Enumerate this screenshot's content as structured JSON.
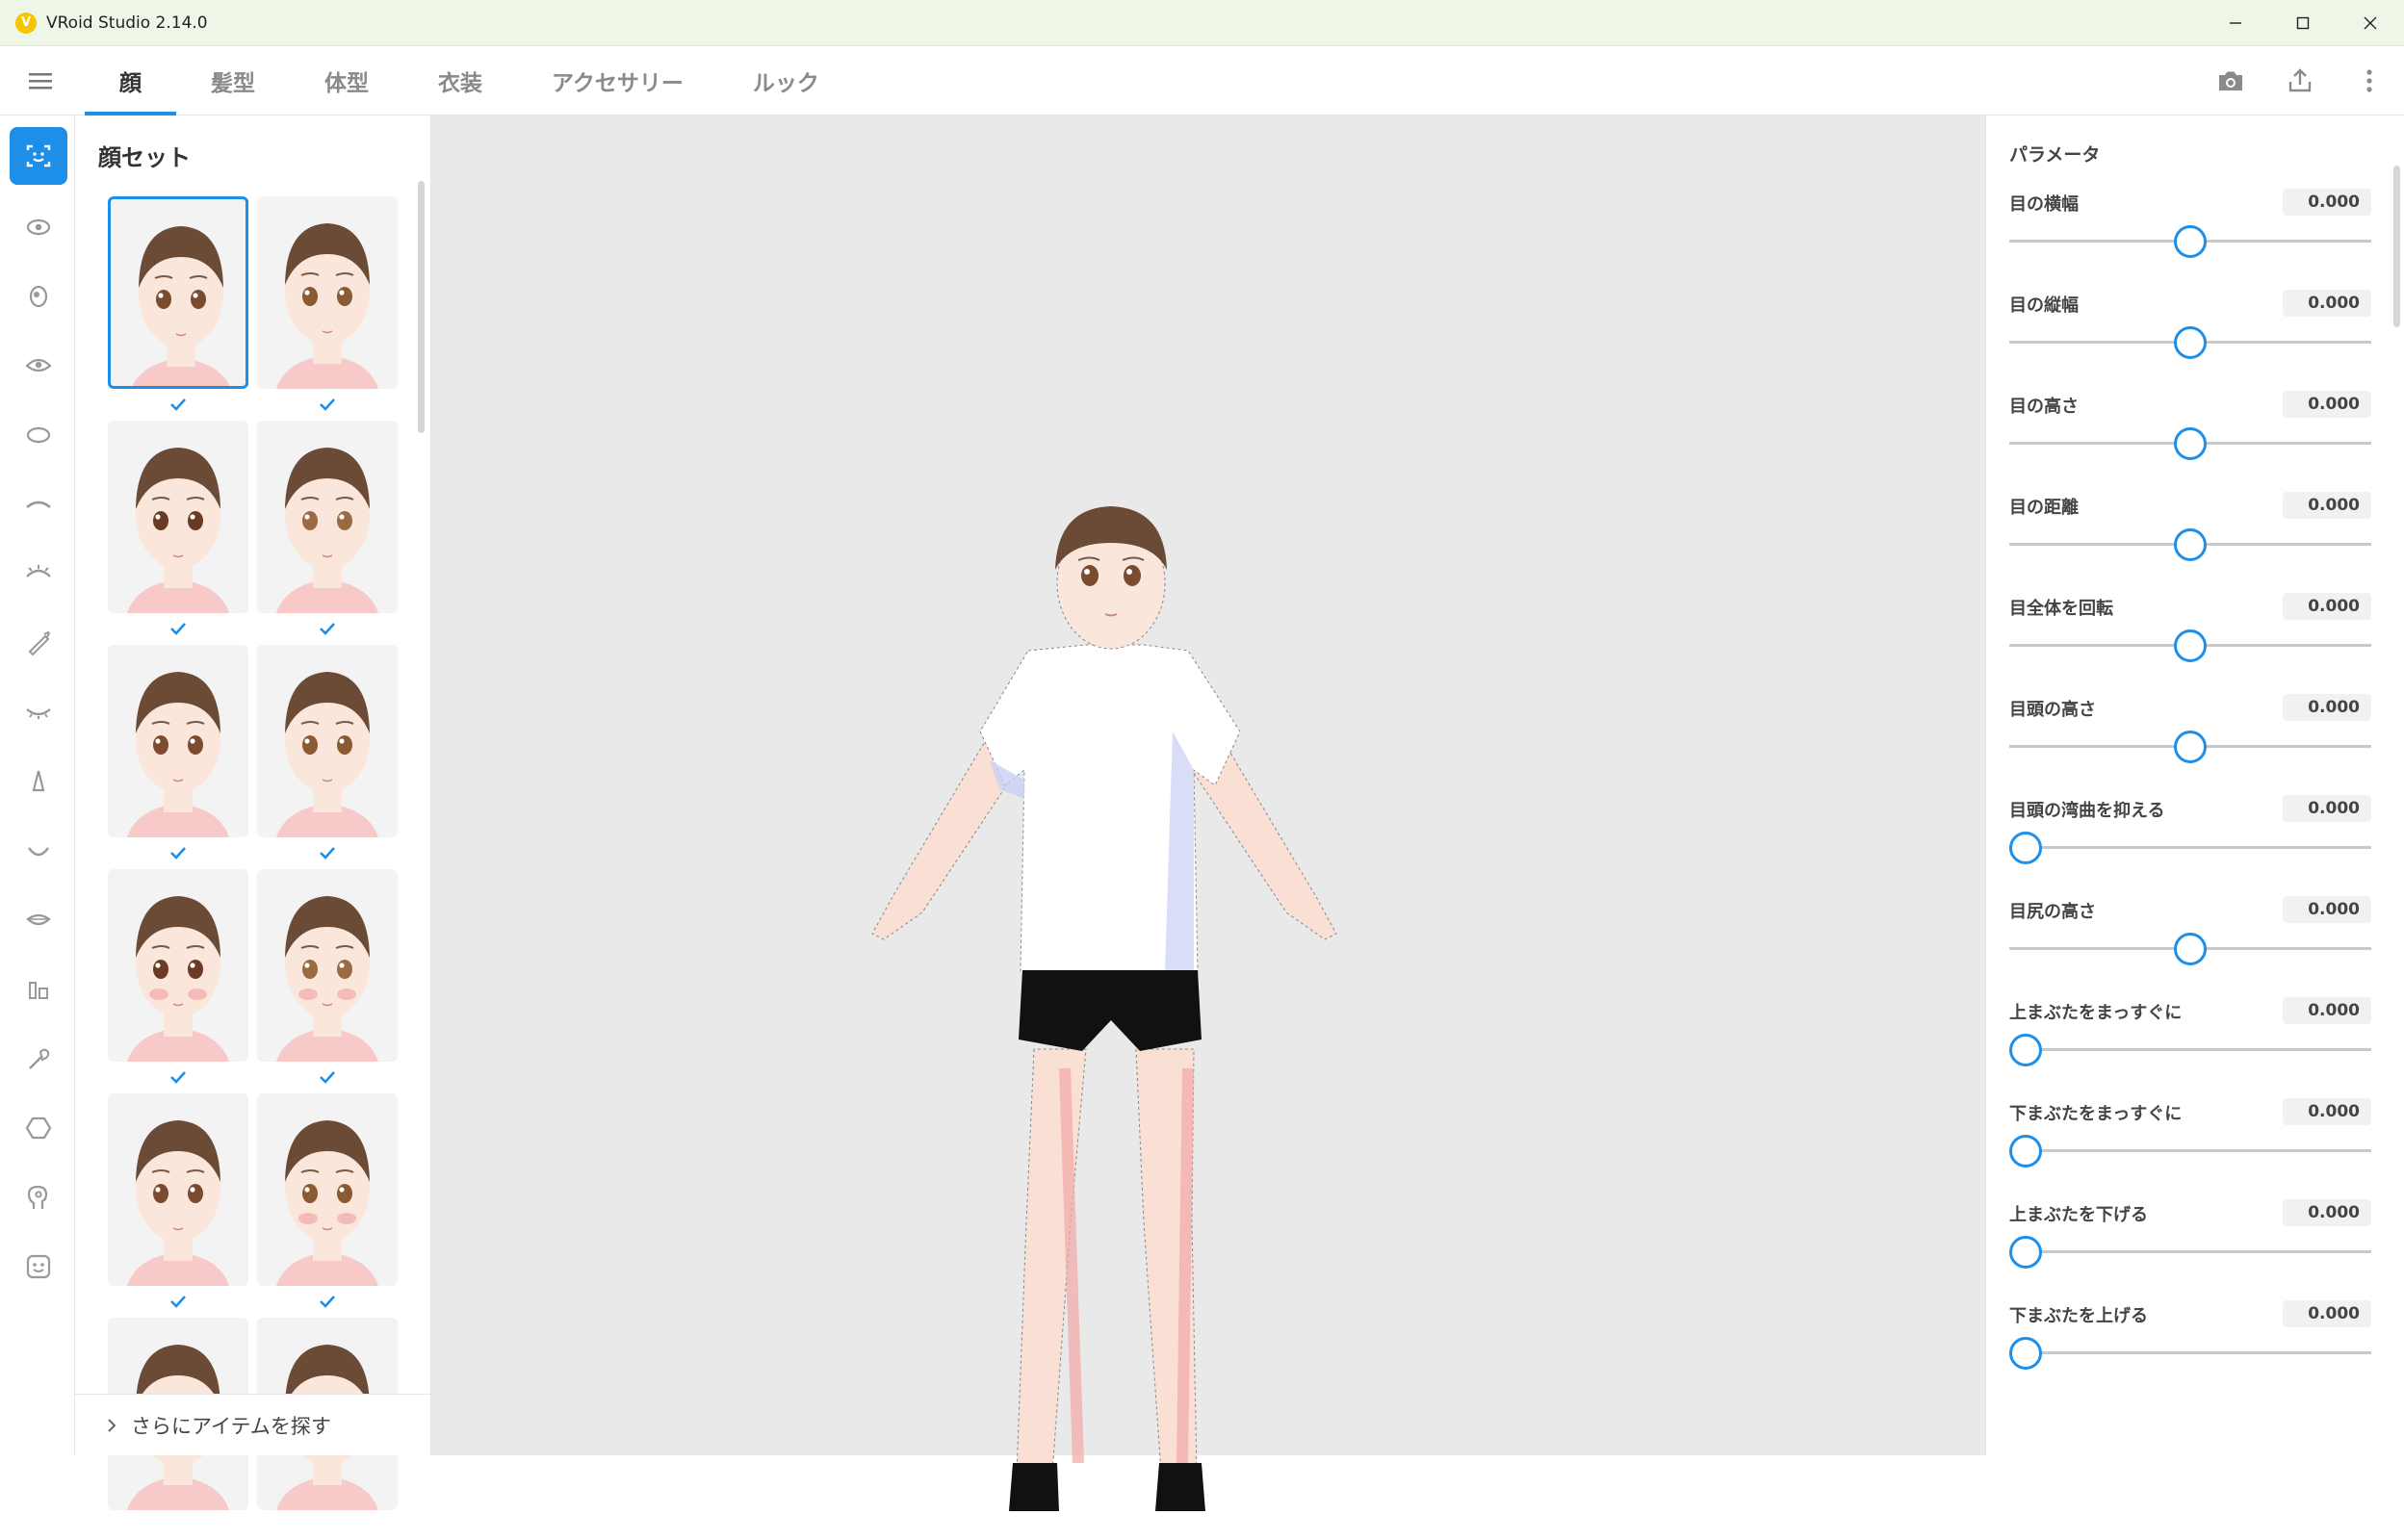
{
  "window": {
    "title": "VRoid Studio 2.14.0"
  },
  "tabs": [
    {
      "label": "顔",
      "active": true
    },
    {
      "label": "髪型",
      "active": false
    },
    {
      "label": "体型",
      "active": false
    },
    {
      "label": "衣装",
      "active": false
    },
    {
      "label": "アクセサリー",
      "active": false
    },
    {
      "label": "ルック",
      "active": false
    }
  ],
  "top_actions": [
    "camera-icon",
    "export-icon",
    "more-vert-icon"
  ],
  "rail_icons": [
    "face-set-icon",
    "eye-set-icon",
    "iris-icon",
    "eye-icon",
    "face-shape-icon",
    "eyebrow-icon",
    "eyelash-icon",
    "eyeliner-icon",
    "eyelid-icon",
    "nose-icon",
    "mouth-icon",
    "lips-icon",
    "teeth-icon",
    "makeup-icon",
    "ears-icon",
    "head-icon",
    "expression-icon"
  ],
  "preset_panel": {
    "title": "顔セット",
    "presets": [
      {
        "variant": 0,
        "selected": true,
        "checked": true
      },
      {
        "variant": 1,
        "selected": false,
        "checked": true
      },
      {
        "variant": 2,
        "selected": false,
        "checked": true
      },
      {
        "variant": 3,
        "selected": false,
        "checked": true
      },
      {
        "variant": 4,
        "selected": false,
        "checked": true
      },
      {
        "variant": 5,
        "selected": false,
        "checked": true
      },
      {
        "variant": 6,
        "selected": false,
        "checked": true
      },
      {
        "variant": 7,
        "selected": false,
        "checked": true
      },
      {
        "variant": 8,
        "selected": false,
        "checked": true
      },
      {
        "variant": 9,
        "selected": false,
        "checked": true
      },
      {
        "variant": 10,
        "selected": false,
        "checked": false
      },
      {
        "variant": 11,
        "selected": false,
        "checked": false
      }
    ],
    "more_label": "さらにアイテムを探す"
  },
  "params": {
    "heading": "パラメータ",
    "items": [
      {
        "label": "目の横幅",
        "value": "0.000",
        "level": 0.5
      },
      {
        "label": "目の縦幅",
        "value": "0.000",
        "level": 0.5
      },
      {
        "label": "目の高さ",
        "value": "0.000",
        "level": 0.5
      },
      {
        "label": "目の距離",
        "value": "0.000",
        "level": 0.5
      },
      {
        "label": "目全体を回転",
        "value": "0.000",
        "level": 0.5
      },
      {
        "label": "目頭の高さ",
        "value": "0.000",
        "level": 0.5
      },
      {
        "label": "目頭の湾曲を抑える",
        "value": "0.000",
        "level": 0.0
      },
      {
        "label": "目尻の高さ",
        "value": "0.000",
        "level": 0.5
      },
      {
        "label": "上まぶたをまっすぐに",
        "value": "0.000",
        "level": 0.0
      },
      {
        "label": "下まぶたをまっすぐに",
        "value": "0.000",
        "level": 0.0
      },
      {
        "label": "上まぶたを下げる",
        "value": "0.000",
        "level": 0.0
      },
      {
        "label": "下まぶたを上げる",
        "value": "0.000",
        "level": 0.0
      }
    ]
  },
  "colors": {
    "accent": "#1e8fe8",
    "viewport_bg": "#e9e9e9"
  }
}
